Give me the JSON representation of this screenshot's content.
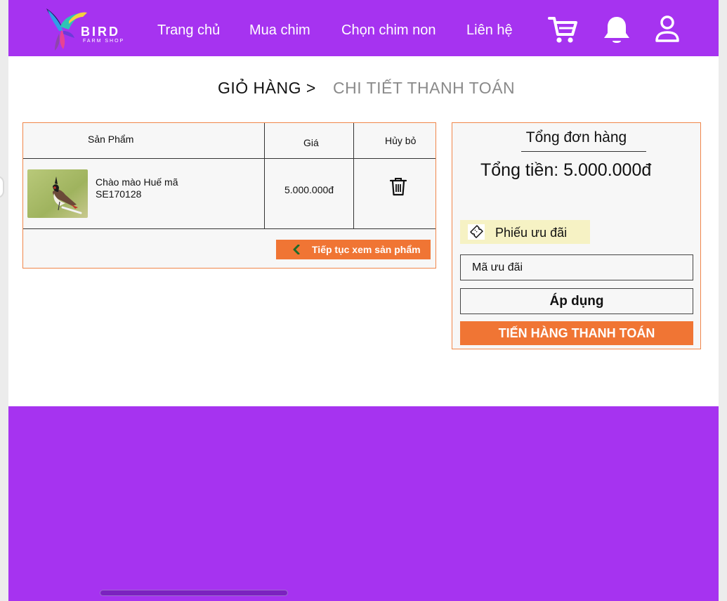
{
  "brand": {
    "name": "BIRD",
    "tagline": "FARM SHOP",
    "colors": {
      "primary": "#a633f0",
      "accent": "#f07534",
      "border": "#f0864a"
    }
  },
  "nav": {
    "items": [
      {
        "label": "Trang chủ"
      },
      {
        "label": "Mua chim"
      },
      {
        "label": "Chọn chim non"
      },
      {
        "label": "Liên hệ"
      }
    ],
    "icons": [
      "cart-icon",
      "bell-icon",
      "user-icon"
    ]
  },
  "breadcrumb": {
    "current": "GIỎ HÀNG >",
    "next": "CHI TIẾT THANH TOÁN"
  },
  "cart": {
    "headers": {
      "product": "Sản Phẩm",
      "price": "Giá",
      "remove": "Hủy bỏ"
    },
    "items": [
      {
        "name": "Chào mào Huế mã",
        "code": "SE170128",
        "price": "5.000.000đ"
      }
    ],
    "continue_label": "Tiếp tục xem sản phẩm"
  },
  "summary": {
    "title": "Tổng đơn hàng",
    "total": "Tổng tiền: 5.000.000đ",
    "voucher_label": "Phiếu ưu đãi",
    "code_placeholder": "Mã ưu đãi",
    "apply_label": "Áp dụng",
    "checkout_label": "TIẾN HÀNG THANH TOÁN"
  }
}
